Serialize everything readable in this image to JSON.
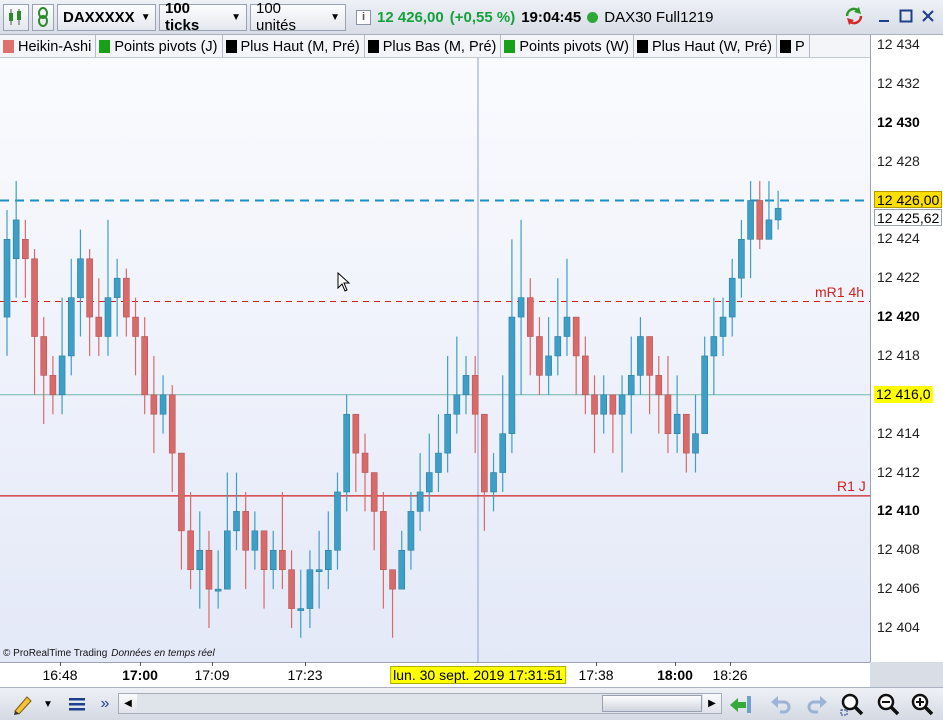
{
  "toolbar": {
    "symbol": "DAXXXXX",
    "interval": "100 ticks",
    "units": "100 unités",
    "info_icon": "info-icon",
    "last_price": "12 426,00",
    "change": "(+0,55 %)",
    "time": "19:04:45",
    "instrument": "DAX30 Full1219"
  },
  "indicators": [
    {
      "label": "Heikin-Ashi",
      "color": "#e06f6f"
    },
    {
      "label": "Points pivots (J)",
      "color": "#18a018"
    },
    {
      "label": "Plus Haut (M, Pré)",
      "color": "#000000"
    },
    {
      "label": "Plus Bas (M, Pré)",
      "color": "#000000"
    },
    {
      "label": "Points pivots (W)",
      "color": "#18a018"
    },
    {
      "label": "Plus Haut (W, Pré)",
      "color": "#000000"
    },
    {
      "label": "P",
      "color": "#000000"
    }
  ],
  "yaxis": {
    "ticks": [
      {
        "label": "12 434",
        "value": 12434,
        "bold": false
      },
      {
        "label": "12 432",
        "value": 12432,
        "bold": false
      },
      {
        "label": "12 430",
        "value": 12430,
        "bold": true
      },
      {
        "label": "12 428",
        "value": 12428,
        "bold": false
      },
      {
        "label": "12 424",
        "value": 12424,
        "bold": false
      },
      {
        "label": "12 422",
        "value": 12422,
        "bold": false
      },
      {
        "label": "12 420",
        "value": 12420,
        "bold": true
      },
      {
        "label": "12 418",
        "value": 12418,
        "bold": false
      },
      {
        "label": "12 414",
        "value": 12414,
        "bold": false
      },
      {
        "label": "12 412",
        "value": 12412,
        "bold": false
      },
      {
        "label": "12 410",
        "value": 12410,
        "bold": true
      },
      {
        "label": "12 408",
        "value": 12408,
        "bold": false
      },
      {
        "label": "12 406",
        "value": 12406,
        "bold": false
      },
      {
        "label": "12 404",
        "value": 12404,
        "bold": false
      }
    ],
    "price_label": "12 426,00",
    "price_value": 12426.0,
    "bid_label": "12 425,62",
    "bid_value": 12425.62,
    "hline_label": "12 416,0",
    "hline_value": 12416.0
  },
  "levels": {
    "mr1": {
      "label": "mR1 4h",
      "value": 12420.8,
      "color": "#d02020"
    },
    "r1": {
      "label": "R1 J",
      "value": 12410.8,
      "color": "#d02020"
    },
    "current": {
      "value": 12426.0,
      "color": "#1a8fc8"
    }
  },
  "xaxis": {
    "ticks": [
      {
        "label": "16:48",
        "bold": false
      },
      {
        "label": "17:00",
        "bold": true
      },
      {
        "label": "17:09",
        "bold": false
      },
      {
        "label": "17:23",
        "bold": false
      },
      {
        "label": "17:38",
        "bold": false
      },
      {
        "label": "18:00",
        "bold": true
      },
      {
        "label": "18:26",
        "bold": false
      }
    ],
    "crosshair_label": "lun. 30 sept. 2019 17:31:51"
  },
  "footer": {
    "copyright": "© ProRealTime Trading",
    "realtime": "Données en temps réel"
  },
  "chart_data": {
    "type": "candlestick-heikin-ashi",
    "up_color": "#3d9fc6",
    "down_color": "#d96a6a",
    "ylim": [
      12403,
      12435
    ],
    "candles": [
      {
        "o": 12420,
        "c": 12424,
        "h": 12425.5,
        "l": 12418
      },
      {
        "o": 12423,
        "c": 12425,
        "h": 12427,
        "l": 12421
      },
      {
        "o": 12424,
        "c": 12423,
        "h": 12425,
        "l": 12421
      },
      {
        "o": 12423,
        "c": 12419,
        "h": 12423.5,
        "l": 12416
      },
      {
        "o": 12419,
        "c": 12417,
        "h": 12420,
        "l": 12414.5
      },
      {
        "o": 12417,
        "c": 12416,
        "h": 12418,
        "l": 12415
      },
      {
        "o": 12416,
        "c": 12418,
        "h": 12421,
        "l": 12415
      },
      {
        "o": 12418,
        "c": 12421,
        "h": 12423,
        "l": 12417
      },
      {
        "o": 12421,
        "c": 12423,
        "h": 12424.5,
        "l": 12419
      },
      {
        "o": 12423,
        "c": 12420,
        "h": 12423.5,
        "l": 12418
      },
      {
        "o": 12420,
        "c": 12419,
        "h": 12422,
        "l": 12418
      },
      {
        "o": 12419,
        "c": 12421,
        "h": 12425,
        "l": 12418
      },
      {
        "o": 12421,
        "c": 12422,
        "h": 12423,
        "l": 12419
      },
      {
        "o": 12422,
        "c": 12420,
        "h": 12422.5,
        "l": 12419
      },
      {
        "o": 12420,
        "c": 12419,
        "h": 12421,
        "l": 12417
      },
      {
        "o": 12419,
        "c": 12416,
        "h": 12420,
        "l": 12415
      },
      {
        "o": 12416,
        "c": 12415,
        "h": 12418,
        "l": 12413
      },
      {
        "o": 12415,
        "c": 12416,
        "h": 12417,
        "l": 12414
      },
      {
        "o": 12416,
        "c": 12413,
        "h": 12416.5,
        "l": 12411
      },
      {
        "o": 12413,
        "c": 12409,
        "h": 12413,
        "l": 12407
      },
      {
        "o": 12409,
        "c": 12407,
        "h": 12411,
        "l": 12406
      },
      {
        "o": 12407,
        "c": 12408,
        "h": 12410,
        "l": 12405
      },
      {
        "o": 12408,
        "c": 12406,
        "h": 12409,
        "l": 12404
      },
      {
        "o": 12406,
        "c": 12406,
        "h": 12408,
        "l": 12405
      },
      {
        "o": 12406,
        "c": 12409,
        "h": 12412,
        "l": 12406
      },
      {
        "o": 12409,
        "c": 12410,
        "h": 12412,
        "l": 12408
      },
      {
        "o": 12410,
        "c": 12408,
        "h": 12411,
        "l": 12406
      },
      {
        "o": 12408,
        "c": 12409,
        "h": 12410,
        "l": 12407
      },
      {
        "o": 12409,
        "c": 12407,
        "h": 12409,
        "l": 12405
      },
      {
        "o": 12407,
        "c": 12408,
        "h": 12409,
        "l": 12406
      },
      {
        "o": 12408,
        "c": 12407,
        "h": 12411,
        "l": 12406
      },
      {
        "o": 12407,
        "c": 12405,
        "h": 12408,
        "l": 12404
      },
      {
        "o": 12405,
        "c": 12405,
        "h": 12407,
        "l": 12403.5
      },
      {
        "o": 12405,
        "c": 12407,
        "h": 12408,
        "l": 12404
      },
      {
        "o": 12407,
        "c": 12407,
        "h": 12409,
        "l": 12405
      },
      {
        "o": 12407,
        "c": 12408,
        "h": 12410,
        "l": 12406
      },
      {
        "o": 12408,
        "c": 12411,
        "h": 12412,
        "l": 12407
      },
      {
        "o": 12411,
        "c": 12415,
        "h": 12416,
        "l": 12410
      },
      {
        "o": 12415,
        "c": 12413,
        "h": 12415,
        "l": 12411
      },
      {
        "o": 12413,
        "c": 12412,
        "h": 12414,
        "l": 12410
      },
      {
        "o": 12412,
        "c": 12410,
        "h": 12412,
        "l": 12408
      },
      {
        "o": 12410,
        "c": 12407,
        "h": 12411,
        "l": 12405
      },
      {
        "o": 12407,
        "c": 12406,
        "h": 12407,
        "l": 12403.5
      },
      {
        "o": 12406,
        "c": 12408,
        "h": 12409,
        "l": 12406
      },
      {
        "o": 12408,
        "c": 12410,
        "h": 12411,
        "l": 12407
      },
      {
        "o": 12410,
        "c": 12411,
        "h": 12413,
        "l": 12409
      },
      {
        "o": 12411,
        "c": 12412,
        "h": 12414,
        "l": 12410
      },
      {
        "o": 12412,
        "c": 12413,
        "h": 12415,
        "l": 12411
      },
      {
        "o": 12413,
        "c": 12415,
        "h": 12418,
        "l": 12412
      },
      {
        "o": 12415,
        "c": 12416,
        "h": 12419,
        "l": 12414
      },
      {
        "o": 12416,
        "c": 12417,
        "h": 12418,
        "l": 12415
      },
      {
        "o": 12417,
        "c": 12415,
        "h": 12418,
        "l": 12413
      },
      {
        "o": 12415,
        "c": 12411,
        "h": 12415,
        "l": 12409
      },
      {
        "o": 12411,
        "c": 12412,
        "h": 12413,
        "l": 12410
      },
      {
        "o": 12412,
        "c": 12414,
        "h": 12417,
        "l": 12411
      },
      {
        "o": 12414,
        "c": 12420,
        "h": 12424,
        "l": 12413
      },
      {
        "o": 12420,
        "c": 12421,
        "h": 12425,
        "l": 12416
      },
      {
        "o": 12421,
        "c": 12419,
        "h": 12422,
        "l": 12417
      },
      {
        "o": 12419,
        "c": 12417,
        "h": 12420,
        "l": 12416
      },
      {
        "o": 12417,
        "c": 12418,
        "h": 12420,
        "l": 12416
      },
      {
        "o": 12418,
        "c": 12419,
        "h": 12422,
        "l": 12417
      },
      {
        "o": 12419,
        "c": 12420,
        "h": 12423,
        "l": 12418
      },
      {
        "o": 12420,
        "c": 12418,
        "h": 12420,
        "l": 12416
      },
      {
        "o": 12418,
        "c": 12416,
        "h": 12419,
        "l": 12415
      },
      {
        "o": 12416,
        "c": 12415,
        "h": 12417,
        "l": 12413
      },
      {
        "o": 12415,
        "c": 12416,
        "h": 12417,
        "l": 12414
      },
      {
        "o": 12416,
        "c": 12415,
        "h": 12416,
        "l": 12413
      },
      {
        "o": 12415,
        "c": 12416,
        "h": 12417,
        "l": 12412
      },
      {
        "o": 12416,
        "c": 12417,
        "h": 12419,
        "l": 12414
      },
      {
        "o": 12417,
        "c": 12419,
        "h": 12420,
        "l": 12416
      },
      {
        "o": 12419,
        "c": 12417,
        "h": 12419,
        "l": 12415
      },
      {
        "o": 12417,
        "c": 12416,
        "h": 12418,
        "l": 12414
      },
      {
        "o": 12416,
        "c": 12414,
        "h": 12418,
        "l": 12413
      },
      {
        "o": 12414,
        "c": 12415,
        "h": 12417,
        "l": 12413
      },
      {
        "o": 12415,
        "c": 12413,
        "h": 12415,
        "l": 12412
      },
      {
        "o": 12413,
        "c": 12414,
        "h": 12416,
        "l": 12412
      },
      {
        "o": 12414,
        "c": 12418,
        "h": 12419,
        "l": 12414
      },
      {
        "o": 12418,
        "c": 12419,
        "h": 12421,
        "l": 12416
      },
      {
        "o": 12419,
        "c": 12420,
        "h": 12421,
        "l": 12418
      },
      {
        "o": 12420,
        "c": 12422,
        "h": 12423,
        "l": 12419
      },
      {
        "o": 12422,
        "c": 12424,
        "h": 12425,
        "l": 12421
      },
      {
        "o": 12424,
        "c": 12426,
        "h": 12427,
        "l": 12422
      },
      {
        "o": 12426,
        "c": 12424,
        "h": 12427,
        "l": 12423.5
      },
      {
        "o": 12424,
        "c": 12425,
        "h": 12427,
        "l": 12424
      },
      {
        "o": 12425,
        "c": 12425.6,
        "h": 12426.5,
        "l": 12424.5
      }
    ]
  }
}
